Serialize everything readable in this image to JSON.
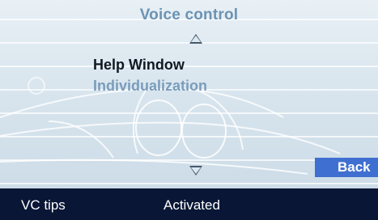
{
  "header": {
    "title": "Voice control"
  },
  "menu": {
    "items": [
      {
        "label": "Help Window",
        "state": "selected"
      },
      {
        "label": "Individualization",
        "state": "normal"
      }
    ]
  },
  "icons": {
    "scroll_up": "triangle-up-outline",
    "scroll_down": "triangle-down-outline"
  },
  "actions": {
    "back_label": "Back"
  },
  "footer": {
    "left_label": "VC tips",
    "right_label": "Activated"
  },
  "colors": {
    "title_text": "#6c93b3",
    "selected_text": "#101822",
    "inactive_text": "#7a9cbc",
    "back_button": "#3f6fd0",
    "footer_bar": "#091636"
  }
}
